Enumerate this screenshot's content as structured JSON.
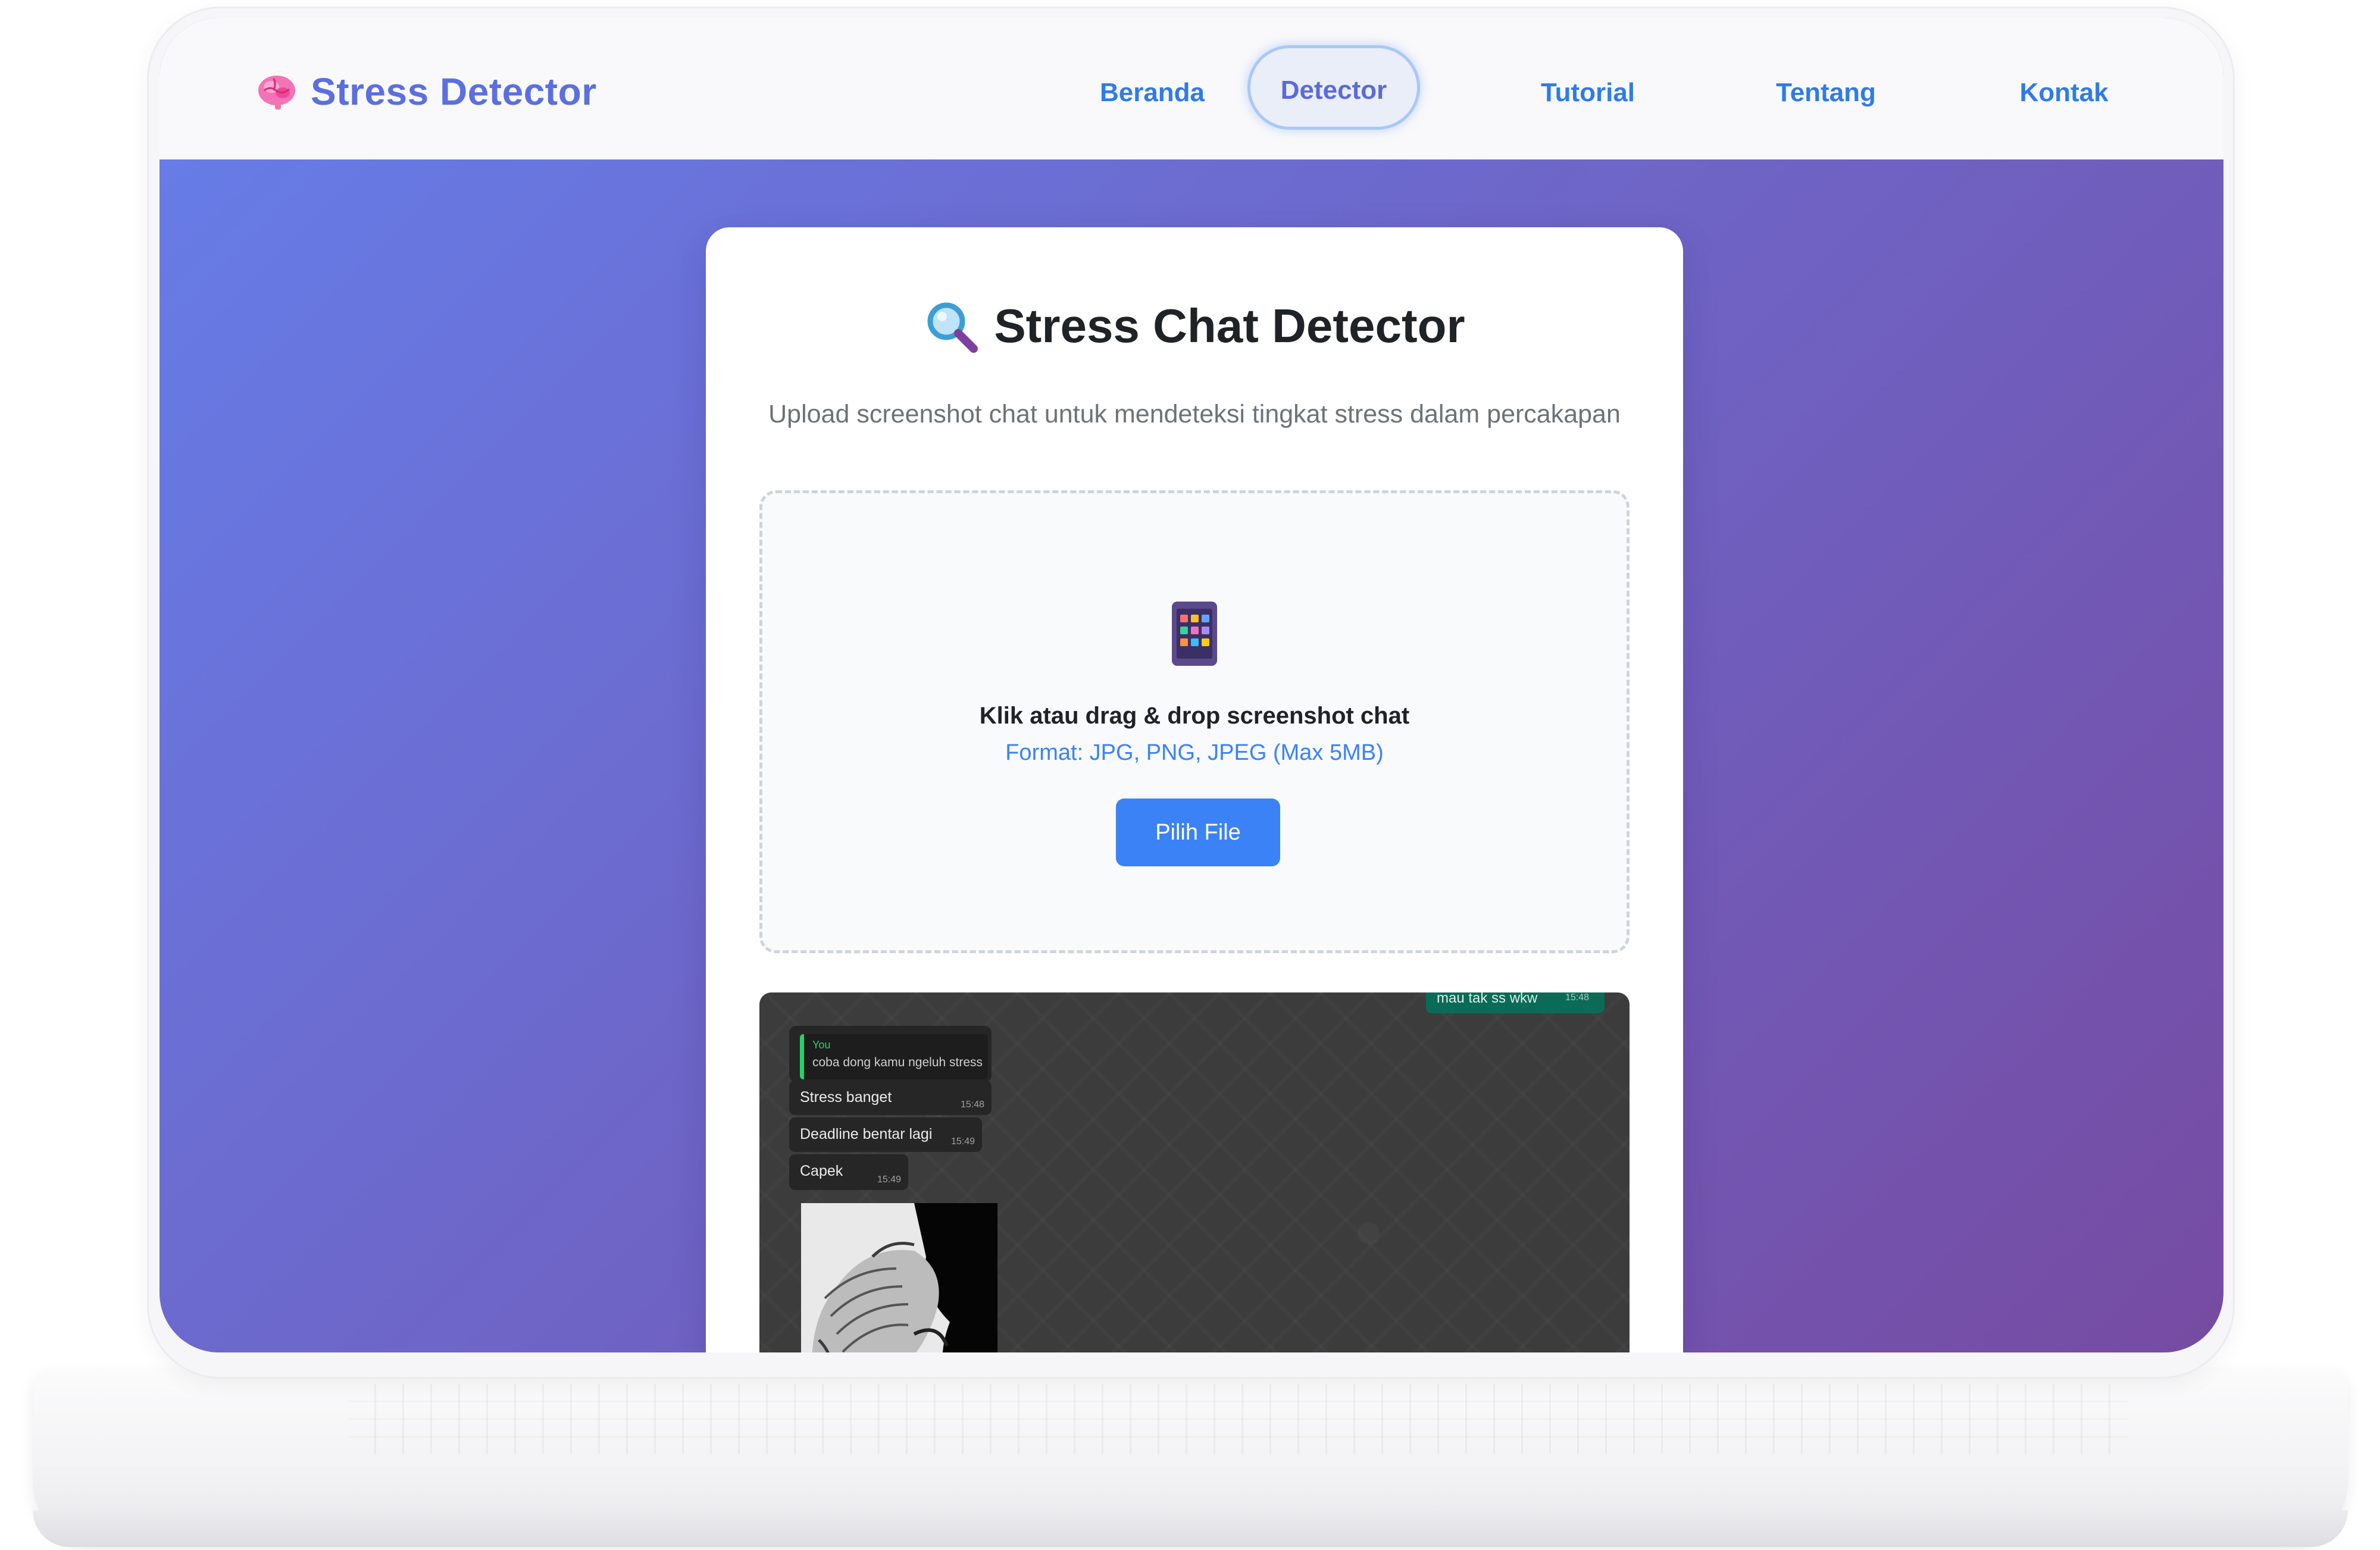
{
  "navbar": {
    "brand": "Stress Detector",
    "links": [
      "Beranda",
      "Detector",
      "Tutorial",
      "Tentang",
      "Kontak"
    ],
    "active": "Detector"
  },
  "card": {
    "title": "Stress Chat Detector",
    "subtitle": "Upload screenshot chat untuk mendeteksi tingkat stress dalam percakapan",
    "upload": {
      "main_text": "Klik atau drag & drop screenshot chat",
      "format_text": "Format: JPG, PNG, JPEG (Max 5MB)",
      "button": "Pilih File"
    }
  },
  "preview": {
    "outgoing": {
      "text": "mau tak ss wkw",
      "time": "15:48"
    },
    "quote": {
      "name": "You",
      "text": "coba dong kamu ngeluh stress"
    },
    "messages": [
      {
        "text": "Stress banget",
        "time": "15:48"
      },
      {
        "text": "Deadline bentar lagi",
        "time": "15:49"
      },
      {
        "text": "Capek",
        "time": "15:49"
      }
    ]
  },
  "colors": {
    "gradient_start": "#667eea",
    "gradient_end": "#764ba2",
    "nav_link": "#2f7be8",
    "primary_button": "#3b82f6",
    "brand_text": "#5b6fe0"
  },
  "icons": {
    "brand": "brain-icon",
    "title": "magnifier-icon",
    "upload": "phone-icon"
  }
}
